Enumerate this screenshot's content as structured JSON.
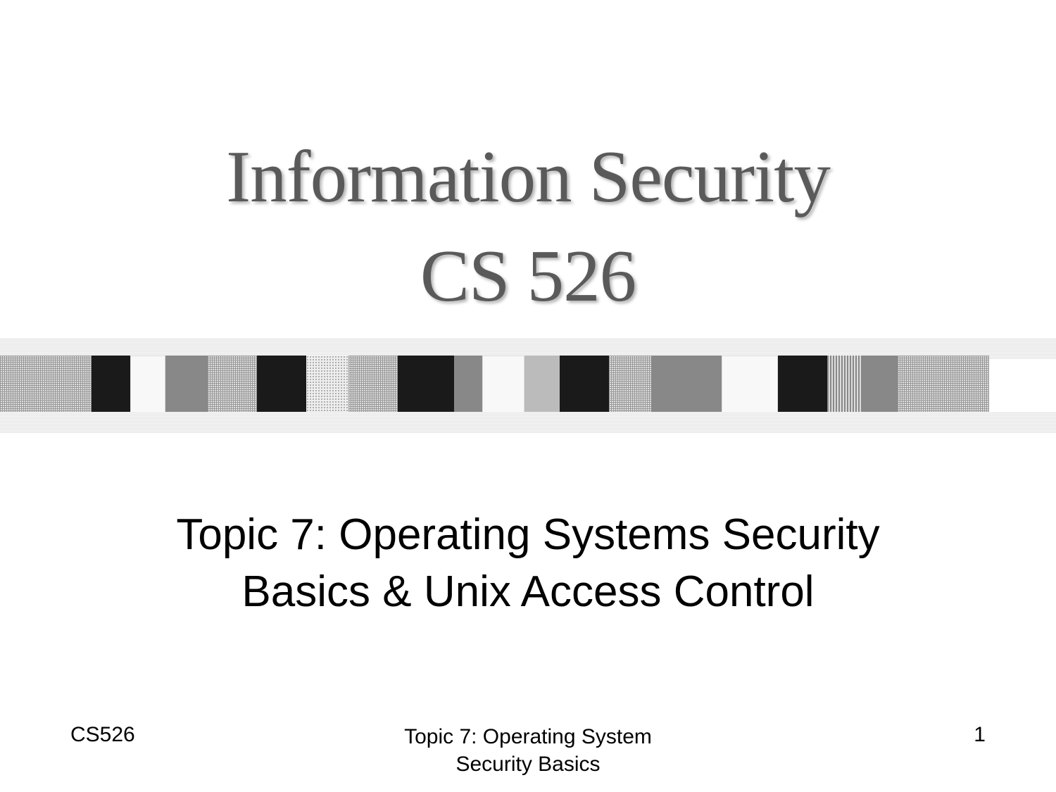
{
  "title": {
    "line1": "Information Security",
    "line2": "CS 526"
  },
  "subtitle": {
    "line1": "Topic 7: Operating Systems Security",
    "line2": "Basics & Unix Access Control"
  },
  "footer": {
    "left": "CS526",
    "center_line1": "Topic 7: Operating System",
    "center_line2": "Security Basics",
    "page_number": "1"
  }
}
